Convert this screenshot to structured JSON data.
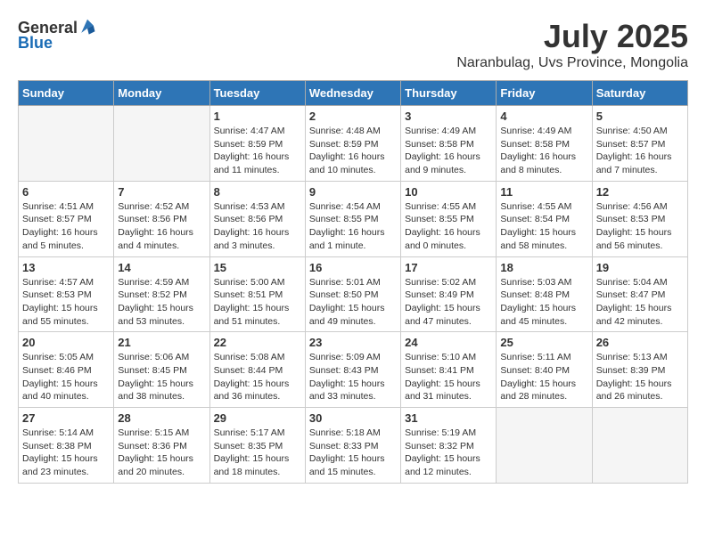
{
  "logo": {
    "general": "General",
    "blue": "Blue"
  },
  "title": "July 2025",
  "subtitle": "Naranbulag, Uvs Province, Mongolia",
  "weekdays": [
    "Sunday",
    "Monday",
    "Tuesday",
    "Wednesday",
    "Thursday",
    "Friday",
    "Saturday"
  ],
  "weeks": [
    [
      {
        "day": "",
        "info": ""
      },
      {
        "day": "",
        "info": ""
      },
      {
        "day": "1",
        "info": "Sunrise: 4:47 AM\nSunset: 8:59 PM\nDaylight: 16 hours and 11 minutes."
      },
      {
        "day": "2",
        "info": "Sunrise: 4:48 AM\nSunset: 8:59 PM\nDaylight: 16 hours and 10 minutes."
      },
      {
        "day": "3",
        "info": "Sunrise: 4:49 AM\nSunset: 8:58 PM\nDaylight: 16 hours and 9 minutes."
      },
      {
        "day": "4",
        "info": "Sunrise: 4:49 AM\nSunset: 8:58 PM\nDaylight: 16 hours and 8 minutes."
      },
      {
        "day": "5",
        "info": "Sunrise: 4:50 AM\nSunset: 8:57 PM\nDaylight: 16 hours and 7 minutes."
      }
    ],
    [
      {
        "day": "6",
        "info": "Sunrise: 4:51 AM\nSunset: 8:57 PM\nDaylight: 16 hours and 5 minutes."
      },
      {
        "day": "7",
        "info": "Sunrise: 4:52 AM\nSunset: 8:56 PM\nDaylight: 16 hours and 4 minutes."
      },
      {
        "day": "8",
        "info": "Sunrise: 4:53 AM\nSunset: 8:56 PM\nDaylight: 16 hours and 3 minutes."
      },
      {
        "day": "9",
        "info": "Sunrise: 4:54 AM\nSunset: 8:55 PM\nDaylight: 16 hours and 1 minute."
      },
      {
        "day": "10",
        "info": "Sunrise: 4:55 AM\nSunset: 8:55 PM\nDaylight: 16 hours and 0 minutes."
      },
      {
        "day": "11",
        "info": "Sunrise: 4:55 AM\nSunset: 8:54 PM\nDaylight: 15 hours and 58 minutes."
      },
      {
        "day": "12",
        "info": "Sunrise: 4:56 AM\nSunset: 8:53 PM\nDaylight: 15 hours and 56 minutes."
      }
    ],
    [
      {
        "day": "13",
        "info": "Sunrise: 4:57 AM\nSunset: 8:53 PM\nDaylight: 15 hours and 55 minutes."
      },
      {
        "day": "14",
        "info": "Sunrise: 4:59 AM\nSunset: 8:52 PM\nDaylight: 15 hours and 53 minutes."
      },
      {
        "day": "15",
        "info": "Sunrise: 5:00 AM\nSunset: 8:51 PM\nDaylight: 15 hours and 51 minutes."
      },
      {
        "day": "16",
        "info": "Sunrise: 5:01 AM\nSunset: 8:50 PM\nDaylight: 15 hours and 49 minutes."
      },
      {
        "day": "17",
        "info": "Sunrise: 5:02 AM\nSunset: 8:49 PM\nDaylight: 15 hours and 47 minutes."
      },
      {
        "day": "18",
        "info": "Sunrise: 5:03 AM\nSunset: 8:48 PM\nDaylight: 15 hours and 45 minutes."
      },
      {
        "day": "19",
        "info": "Sunrise: 5:04 AM\nSunset: 8:47 PM\nDaylight: 15 hours and 42 minutes."
      }
    ],
    [
      {
        "day": "20",
        "info": "Sunrise: 5:05 AM\nSunset: 8:46 PM\nDaylight: 15 hours and 40 minutes."
      },
      {
        "day": "21",
        "info": "Sunrise: 5:06 AM\nSunset: 8:45 PM\nDaylight: 15 hours and 38 minutes."
      },
      {
        "day": "22",
        "info": "Sunrise: 5:08 AM\nSunset: 8:44 PM\nDaylight: 15 hours and 36 minutes."
      },
      {
        "day": "23",
        "info": "Sunrise: 5:09 AM\nSunset: 8:43 PM\nDaylight: 15 hours and 33 minutes."
      },
      {
        "day": "24",
        "info": "Sunrise: 5:10 AM\nSunset: 8:41 PM\nDaylight: 15 hours and 31 minutes."
      },
      {
        "day": "25",
        "info": "Sunrise: 5:11 AM\nSunset: 8:40 PM\nDaylight: 15 hours and 28 minutes."
      },
      {
        "day": "26",
        "info": "Sunrise: 5:13 AM\nSunset: 8:39 PM\nDaylight: 15 hours and 26 minutes."
      }
    ],
    [
      {
        "day": "27",
        "info": "Sunrise: 5:14 AM\nSunset: 8:38 PM\nDaylight: 15 hours and 23 minutes."
      },
      {
        "day": "28",
        "info": "Sunrise: 5:15 AM\nSunset: 8:36 PM\nDaylight: 15 hours and 20 minutes."
      },
      {
        "day": "29",
        "info": "Sunrise: 5:17 AM\nSunset: 8:35 PM\nDaylight: 15 hours and 18 minutes."
      },
      {
        "day": "30",
        "info": "Sunrise: 5:18 AM\nSunset: 8:33 PM\nDaylight: 15 hours and 15 minutes."
      },
      {
        "day": "31",
        "info": "Sunrise: 5:19 AM\nSunset: 8:32 PM\nDaylight: 15 hours and 12 minutes."
      },
      {
        "day": "",
        "info": ""
      },
      {
        "day": "",
        "info": ""
      }
    ]
  ]
}
